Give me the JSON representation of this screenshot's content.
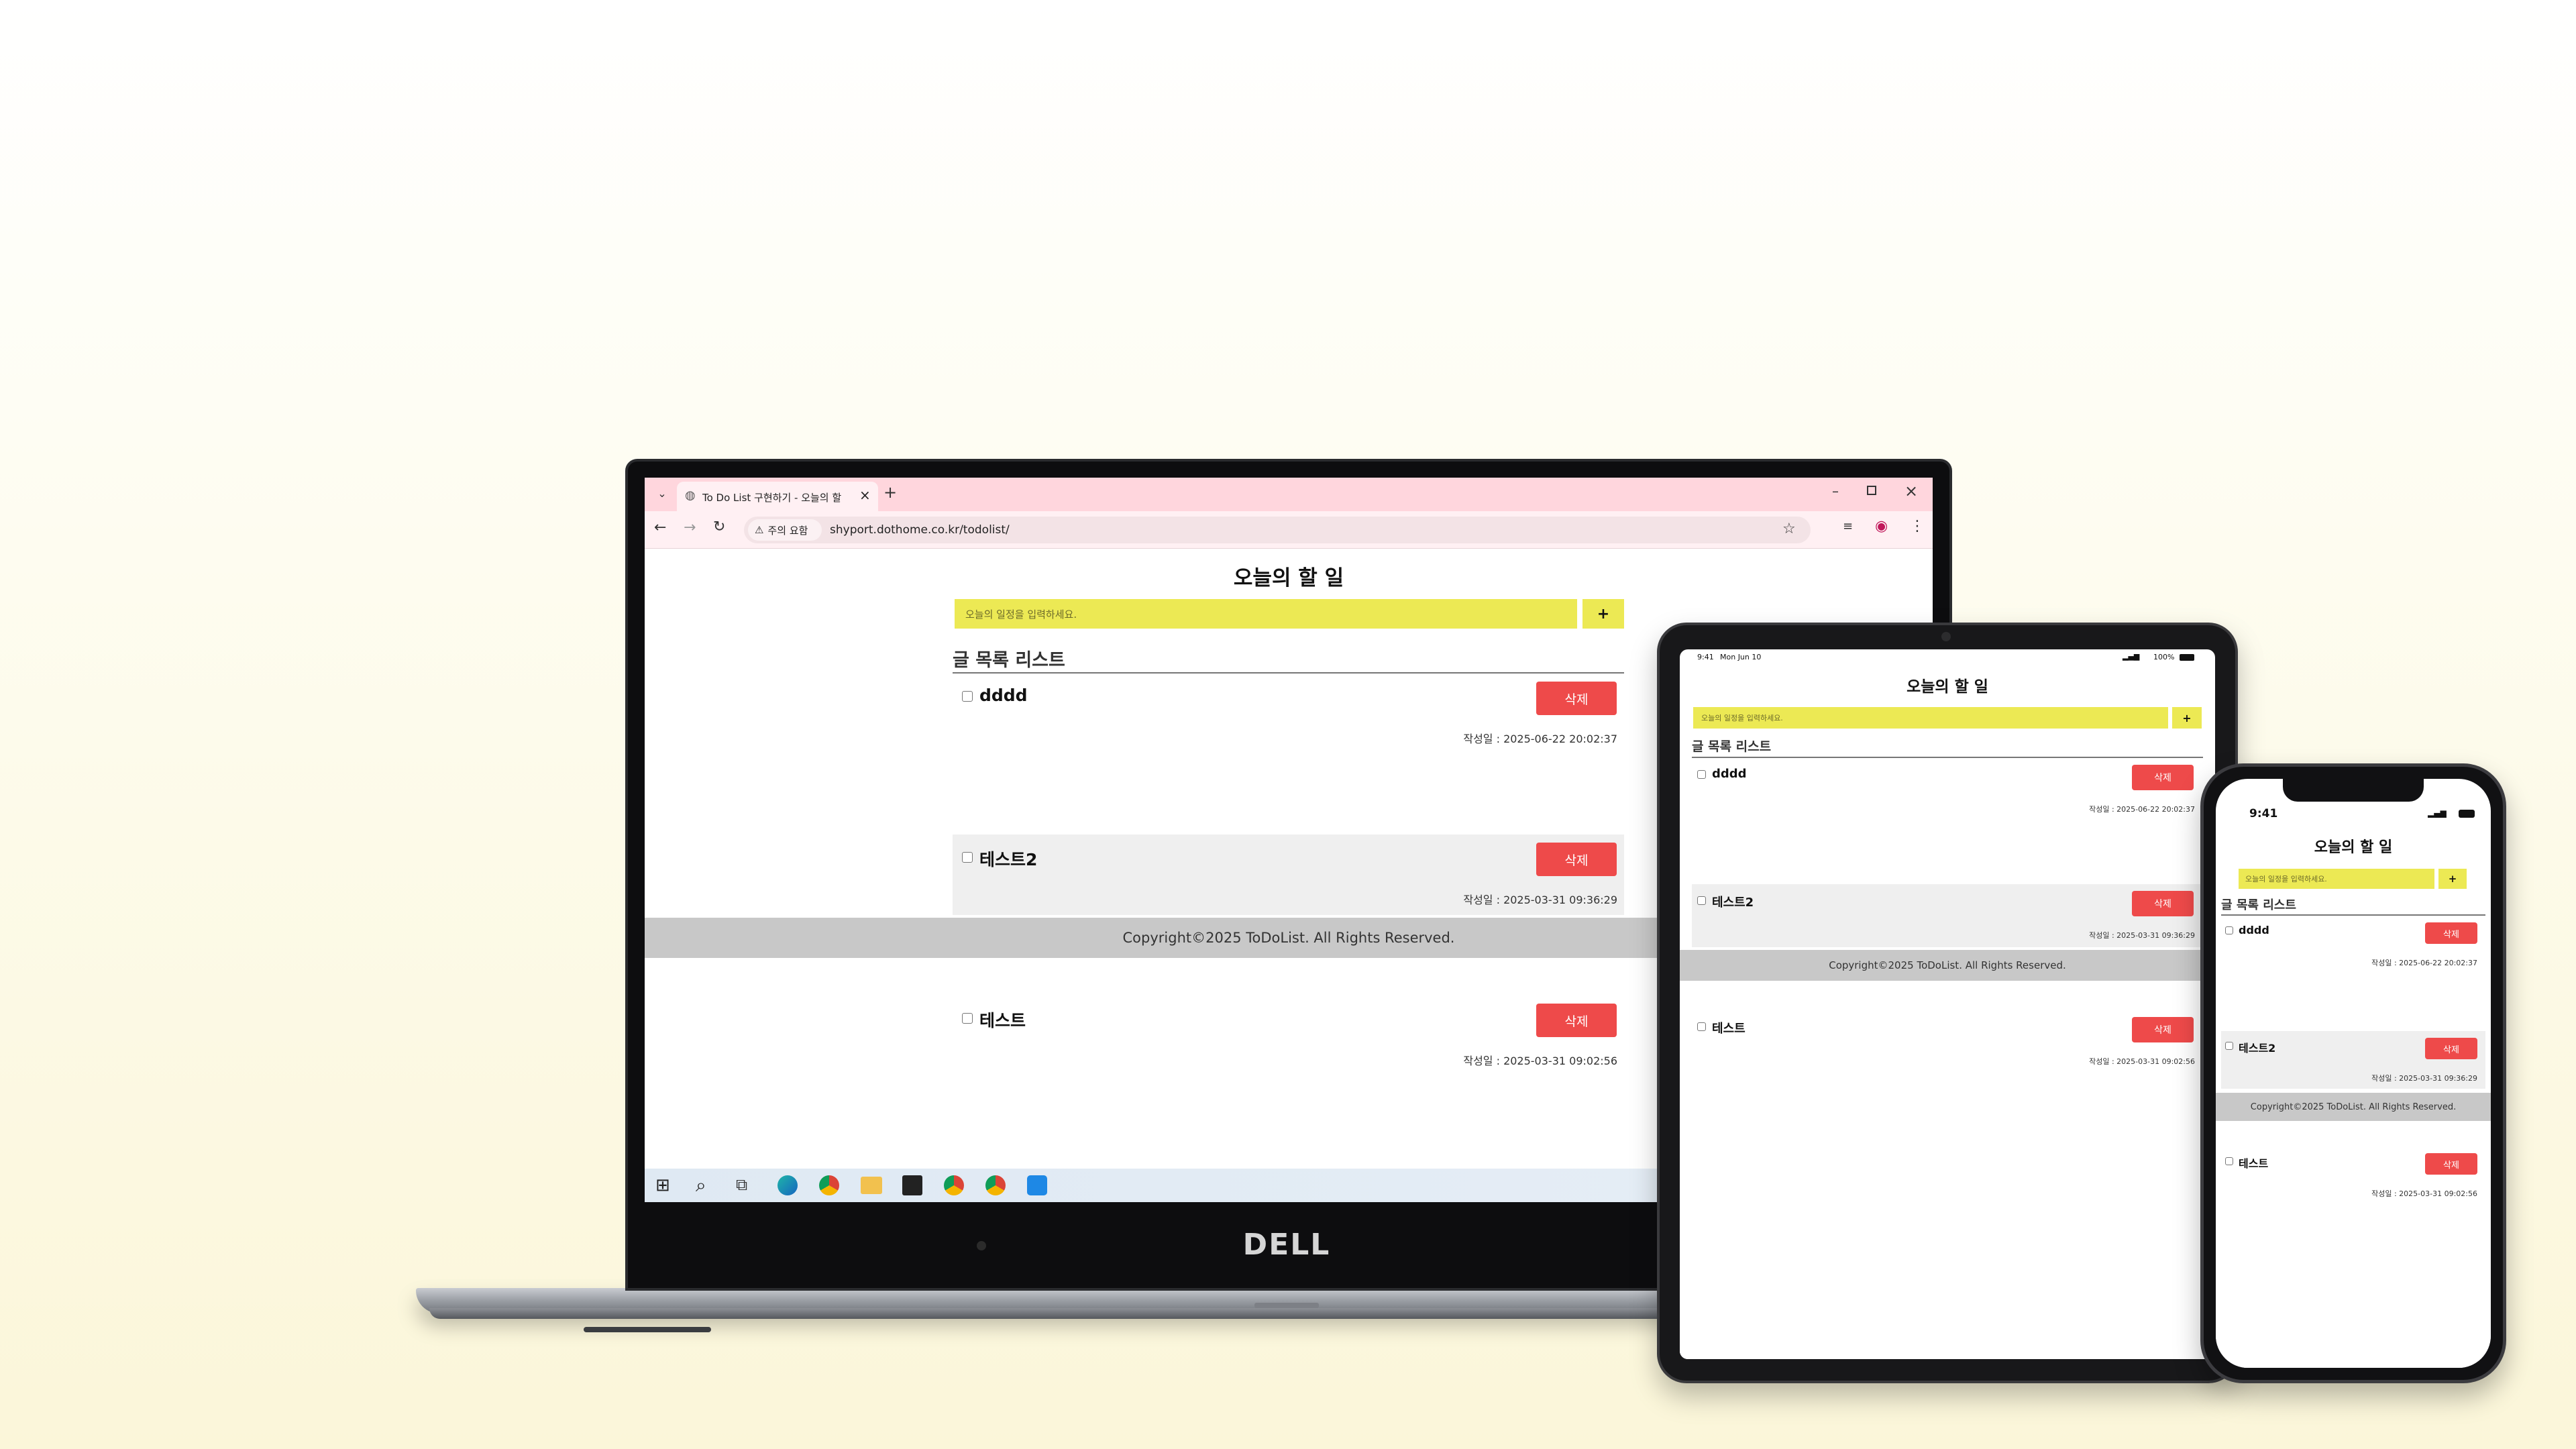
{
  "browser": {
    "tab_title": "To Do List 구현하기 - 오늘의 할",
    "security_label": "주의 요함",
    "url": "shyport.dothome.co.kr/todolist/"
  },
  "app": {
    "title": "오늘의 할 일",
    "input_placeholder": "오늘의 일정을 입력하세요.",
    "add_label": "+",
    "list_heading": "글 목록 리스트",
    "delete_label": "삭제",
    "items": [
      {
        "text": "dddd",
        "date": "작성일 : 2025-06-22 20:02:37"
      },
      {
        "text": "테스트2",
        "date": "작성일 : 2025-03-31 09:36:29"
      },
      {
        "text": "테스트",
        "date": "작성일 : 2025-03-31 09:02:56"
      }
    ],
    "footer": "Copyright©2025 ToDoList. All Rights Reserved."
  },
  "tablet_status": {
    "time": "9:41",
    "date": "Mon Jun 10",
    "battery": "100%"
  },
  "phone_status": {
    "time": "9:41"
  },
  "laptop_brand": "DELL",
  "taskbar_icons": [
    "windows-icon",
    "search-icon",
    "task-view-icon",
    "edge-icon",
    "chrome-icon",
    "file-explorer-icon",
    "sticky-notes-icon",
    "chrome-profile-icon",
    "chrome-profile-2-icon",
    "vscode-icon"
  ]
}
